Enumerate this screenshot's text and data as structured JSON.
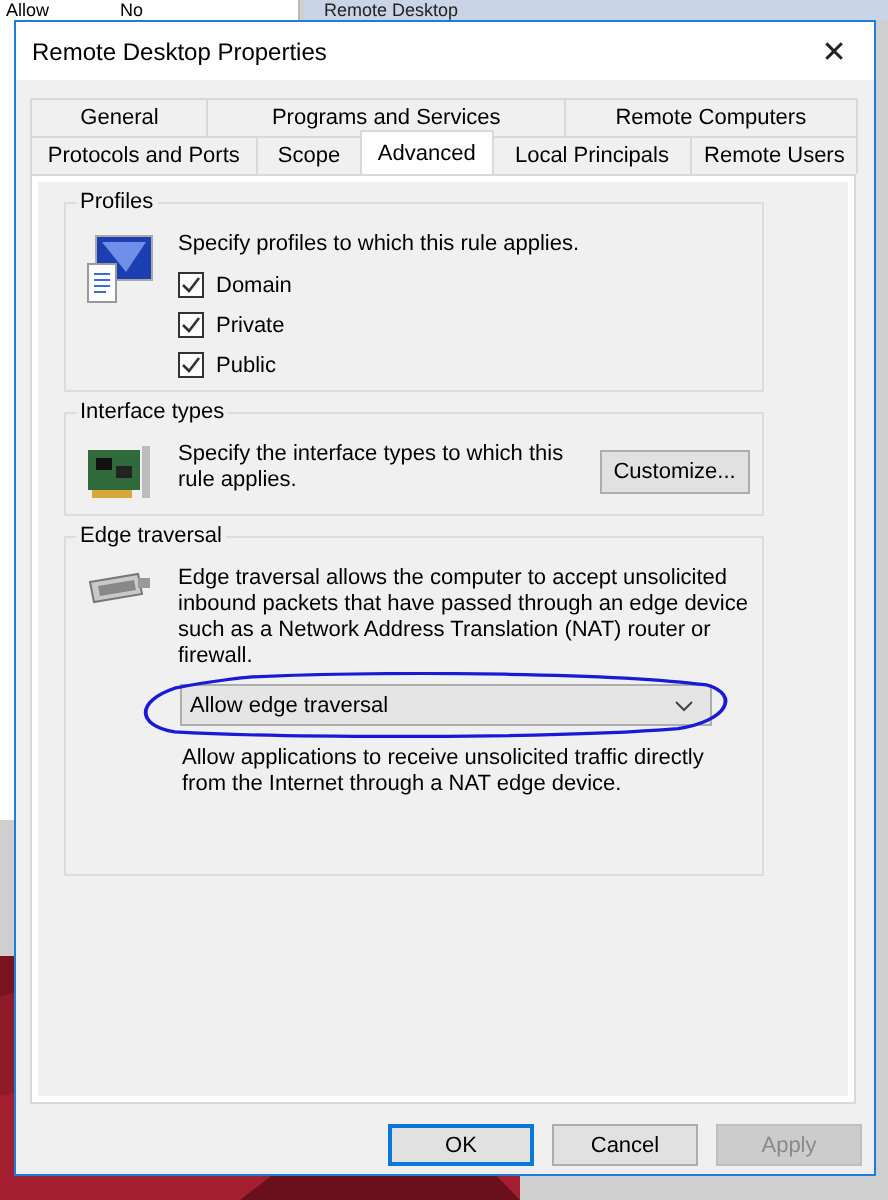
{
  "background": {
    "list_cells": [
      "Allow",
      "No"
    ],
    "window_title": "Remote Desktop"
  },
  "window": {
    "title": "Remote Desktop Properties",
    "close": "✕"
  },
  "tab_rows": [
    [
      {
        "label": "General",
        "selected": false
      },
      {
        "label": "Programs and Services",
        "selected": false
      },
      {
        "label": "Remote Computers",
        "selected": false
      }
    ],
    [
      {
        "label": "Protocols and Ports",
        "selected": false
      },
      {
        "label": "Scope",
        "selected": false
      },
      {
        "label": "Advanced",
        "selected": true
      },
      {
        "label": "Local Principals",
        "selected": false
      },
      {
        "label": "Remote Users",
        "selected": false
      }
    ]
  ],
  "profiles": {
    "title": "Profiles",
    "description": "Specify profiles to which this rule applies.",
    "options": [
      {
        "label": "Domain",
        "checked": true
      },
      {
        "label": "Private",
        "checked": true
      },
      {
        "label": "Public",
        "checked": true
      }
    ]
  },
  "interface_types": {
    "title": "Interface types",
    "description": "Specify the interface types to which this rule applies.",
    "button": "Customize..."
  },
  "edge_traversal": {
    "title": "Edge traversal",
    "description": "Edge traversal allows the computer to accept unsolicited inbound packets that have passed through an edge device such as a Network Address Translation (NAT) router or firewall.",
    "dropdown": {
      "value": "Allow edge traversal",
      "circled": true
    },
    "hint": "Allow applications to receive unsolicited traffic directly from the Internet through a NAT edge device."
  },
  "buttons": [
    {
      "label": "OK",
      "default": true,
      "disabled": false
    },
    {
      "label": "Cancel",
      "default": false,
      "disabled": false
    },
    {
      "label": "Apply",
      "default": false,
      "disabled": true
    }
  ]
}
